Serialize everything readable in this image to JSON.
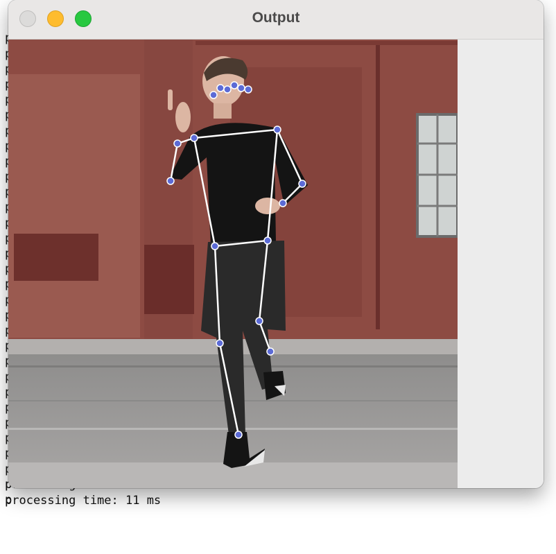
{
  "terminal": {
    "partial_char": "p",
    "visible_lines": [
      "processing time: 11 ms",
      "processing time: 11 ms"
    ]
  },
  "window": {
    "title": "Output",
    "buttons": [
      "close",
      "minimize",
      "zoom"
    ]
  },
  "video_frame": {
    "description_icon": "pose-estimation-frame",
    "colors": {
      "brick": "#8a4a42",
      "brick_dark": "#6b2f2b",
      "road": "#9a9a9a",
      "sidewalk": "#b8b6b5",
      "clothing": "#141414",
      "skeleton_line": "#ffffff",
      "keypoint": "#5c6bd6"
    }
  }
}
